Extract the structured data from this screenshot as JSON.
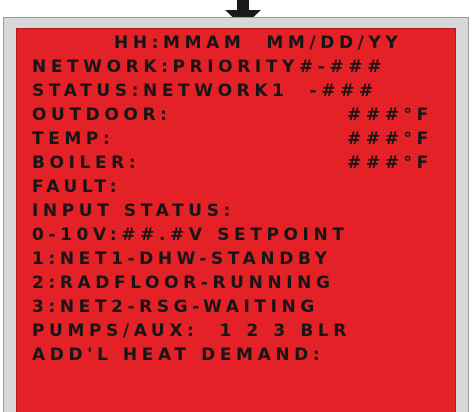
{
  "display": {
    "header": "HH:MMAM  MM/DD/YY",
    "network": "NETWORK:PRIORITY#-###",
    "status": "STATUS:NETWORK1  -###",
    "outdoor_label": "OUTDOOR:",
    "outdoor_value": "###°F",
    "temp_label": "TEMP:",
    "temp_value": "###°F",
    "boiler_label": "BOILER:",
    "boiler_value": "###°F",
    "fault": "FAULT:",
    "input_status": "INPUT STATUS:",
    "voltage_setpoint": "0-10V:##.#V SETPOINT",
    "input_1": "1:NET1-DHW-STANDBY",
    "input_2": "2:RADFLOOR-RUNNING",
    "input_3": "3:NET2-RSG-WAITING",
    "pumps_aux": "PUMPS/AUX:  1 2 3 BLR",
    "heat_demand": "ADD'L HEAT DEMAND:"
  },
  "colors": {
    "screen": "#e32126",
    "text": "#161616",
    "bezel": "#d8d8d8",
    "arrow": "#1a1a1a"
  },
  "icons": {
    "pointer": "down-arrow-icon"
  }
}
